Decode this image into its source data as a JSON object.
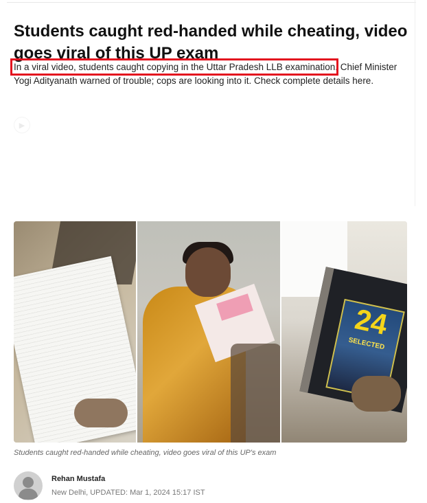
{
  "article": {
    "headline": "Students caught red-handed while cheating, video goes viral of this UP exam",
    "summary_highlighted": "In a viral video, students caught copying in the Uttar Pradesh LLB examination",
    "summary_rest": ". Chief Minister Yogi Adityanath warned of trouble; cops are looking into it. Check complete details here."
  },
  "image": {
    "book_number": "24",
    "book_title": "SELECTED"
  },
  "caption": {
    "text": "Students caught red-handed while cheating, video goes viral of this UP's exam"
  },
  "author": {
    "name": "Rehan Mustafa",
    "meta": "New Delhi, UPDATED: Mar 1, 2024 15:17 IST"
  },
  "colors": {
    "highlight_box": "#e3101e",
    "text": "#111111",
    "muted_text": "#777777"
  },
  "icons": {
    "author_avatar": "person-icon"
  }
}
